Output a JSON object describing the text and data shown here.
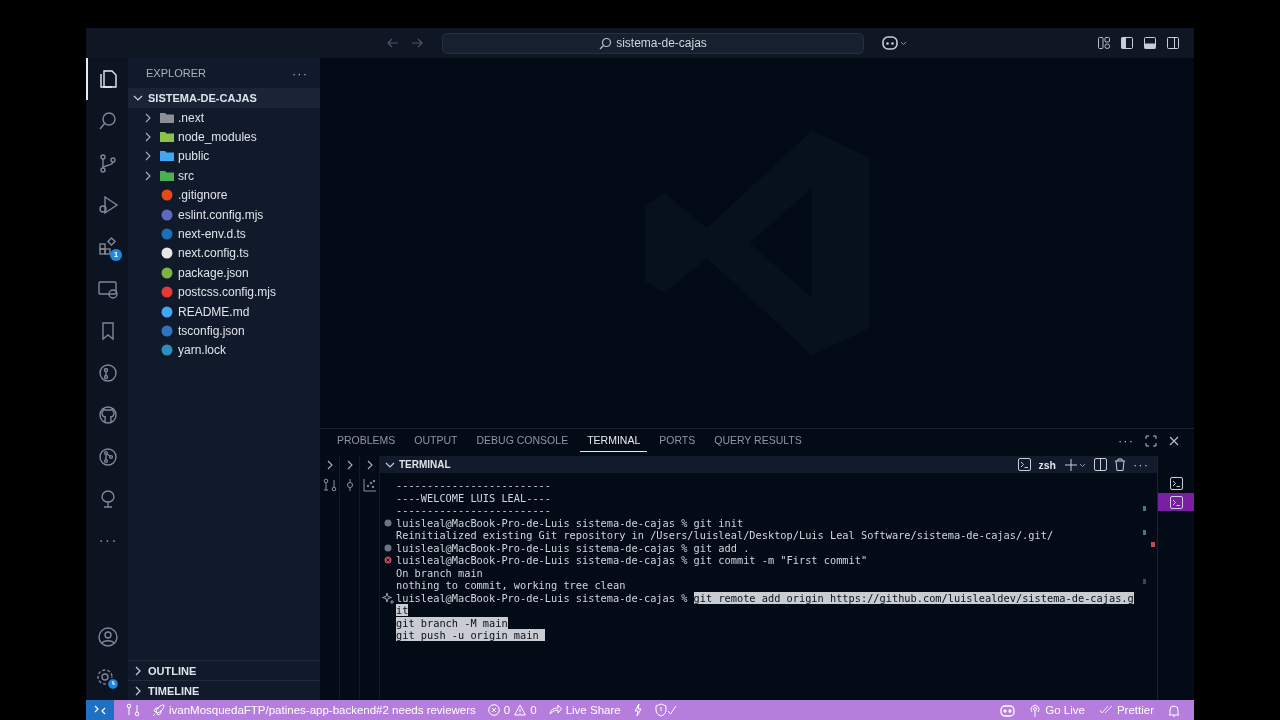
{
  "title_bar": {
    "search": "sistema-de-cajas"
  },
  "activity_bar": {
    "items": [
      {
        "kind": "files",
        "selected": true
      },
      {
        "kind": "search",
        "selected": false
      },
      {
        "kind": "branch",
        "selected": false
      },
      {
        "kind": "debug",
        "selected": false
      },
      {
        "kind": "extensions",
        "selected": false,
        "badge": "1"
      },
      {
        "kind": "remote",
        "selected": false
      },
      {
        "kind": "bookmark",
        "selected": false
      },
      {
        "kind": "gitlens",
        "selected": false
      },
      {
        "kind": "github",
        "selected": false
      },
      {
        "kind": "graph",
        "selected": false
      },
      {
        "kind": "tree",
        "selected": false
      },
      {
        "kind": "more",
        "selected": false,
        "label": "···"
      }
    ],
    "bottom": [
      {
        "kind": "account"
      },
      {
        "kind": "manage"
      }
    ]
  },
  "sidebar": {
    "title": "EXPLORER",
    "actions": "···",
    "folder": {
      "name": "SISTEMA-DE-CAJAS",
      "expanded": true,
      "children": [
        {
          "name": ".next",
          "kind": "folder",
          "expanded": false,
          "color": "#8a8f99"
        },
        {
          "name": "node_modules",
          "kind": "folder",
          "expanded": false,
          "color": "#8bc34a"
        },
        {
          "name": "public",
          "kind": "folder",
          "expanded": false,
          "color": "#42a5f5"
        },
        {
          "name": "src",
          "kind": "folder",
          "expanded": false,
          "color": "#4caf50"
        },
        {
          "name": ".gitignore",
          "kind": "file",
          "color": "#e64a19"
        },
        {
          "name": "eslint.config.mjs",
          "kind": "file",
          "color": "#5c6bc0"
        },
        {
          "name": "next-env.d.ts",
          "kind": "file",
          "color": "#1e6fb8"
        },
        {
          "name": "next.config.ts",
          "kind": "file",
          "color": "#e6e6e6"
        },
        {
          "name": "package.json",
          "kind": "file",
          "color": "#7cb342"
        },
        {
          "name": "postcss.config.mjs",
          "kind": "file",
          "color": "#e53935"
        },
        {
          "name": "README.md",
          "kind": "file",
          "color": "#42a5f5"
        },
        {
          "name": "tsconfig.json",
          "kind": "file",
          "color": "#2f74c0"
        },
        {
          "name": "yarn.lock",
          "kind": "file",
          "color": "#2c8ebb"
        }
      ]
    },
    "sections": [
      {
        "name": "OUTLINE",
        "expanded": false
      },
      {
        "name": "TIMELINE",
        "expanded": false
      }
    ]
  },
  "panel": {
    "tabs": [
      {
        "label": "PROBLEMS",
        "selected": false
      },
      {
        "label": "OUTPUT",
        "selected": false
      },
      {
        "label": "DEBUG CONSOLE",
        "selected": false
      },
      {
        "label": "TERMINAL",
        "selected": true
      },
      {
        "label": "PORTS",
        "selected": false
      },
      {
        "label": "QUERY RESULTS",
        "selected": false
      }
    ],
    "terminal": {
      "title": "TERMINAL",
      "expanded": true,
      "shell": "zsh",
      "lines": [
        {
          "text": "-------------------------"
        },
        {
          "text": "----WELCOME LUIS LEAL----"
        },
        {
          "text": "-------------------------"
        },
        {
          "kind": "done",
          "text": "luisleal@MacBook-Pro-de-Luis sistema-de-cajas % git init"
        },
        {
          "text": "Reinitialized existing Git repository in /Users/luisleal/Desktop/Luis Leal Software/sistema-de-cajas/.git/"
        },
        {
          "kind": "done",
          "text": "luisleal@MacBook-Pro-de-Luis sistema-de-cajas % git add ."
        },
        {
          "kind": "error",
          "text": "luisleal@MacBook-Pro-de-Luis sistema-de-cajas % git commit -m \"First commit\""
        },
        {
          "text": "On branch main"
        },
        {
          "text": "nothing to commit, working tree clean"
        },
        {
          "kind": "ai",
          "text": "luisleal@MacBook-Pro-de-Luis sistema-de-cajas % ",
          "selection": "git remote add origin https://github.com/luislealdev/sistema-de-cajas.g"
        },
        {
          "selection": "it"
        },
        {
          "selection": "git branch -M main"
        },
        {
          "selection": "git push -u origin main "
        }
      ]
    },
    "sessions": [
      {
        "selected": false
      },
      {
        "selected": true
      }
    ]
  },
  "status_bar": {
    "left": [
      {
        "kind": "remote"
      },
      {
        "kind": "compare"
      },
      {
        "kind": "rocket",
        "text": "ivanMosquedaFTP/patines-app-backend#2 needs reviewers"
      },
      {
        "kind": "problems",
        "errors": "0",
        "warnings": "0"
      },
      {
        "kind": "liveshare",
        "text": "Live Share"
      },
      {
        "kind": "bolt"
      },
      {
        "kind": "shield"
      }
    ],
    "right": [
      {
        "kind": "copilot"
      },
      {
        "kind": "broadcast",
        "text": "Go Live"
      },
      {
        "kind": "checks",
        "text": "Prettier"
      },
      {
        "kind": "bell"
      }
    ]
  }
}
